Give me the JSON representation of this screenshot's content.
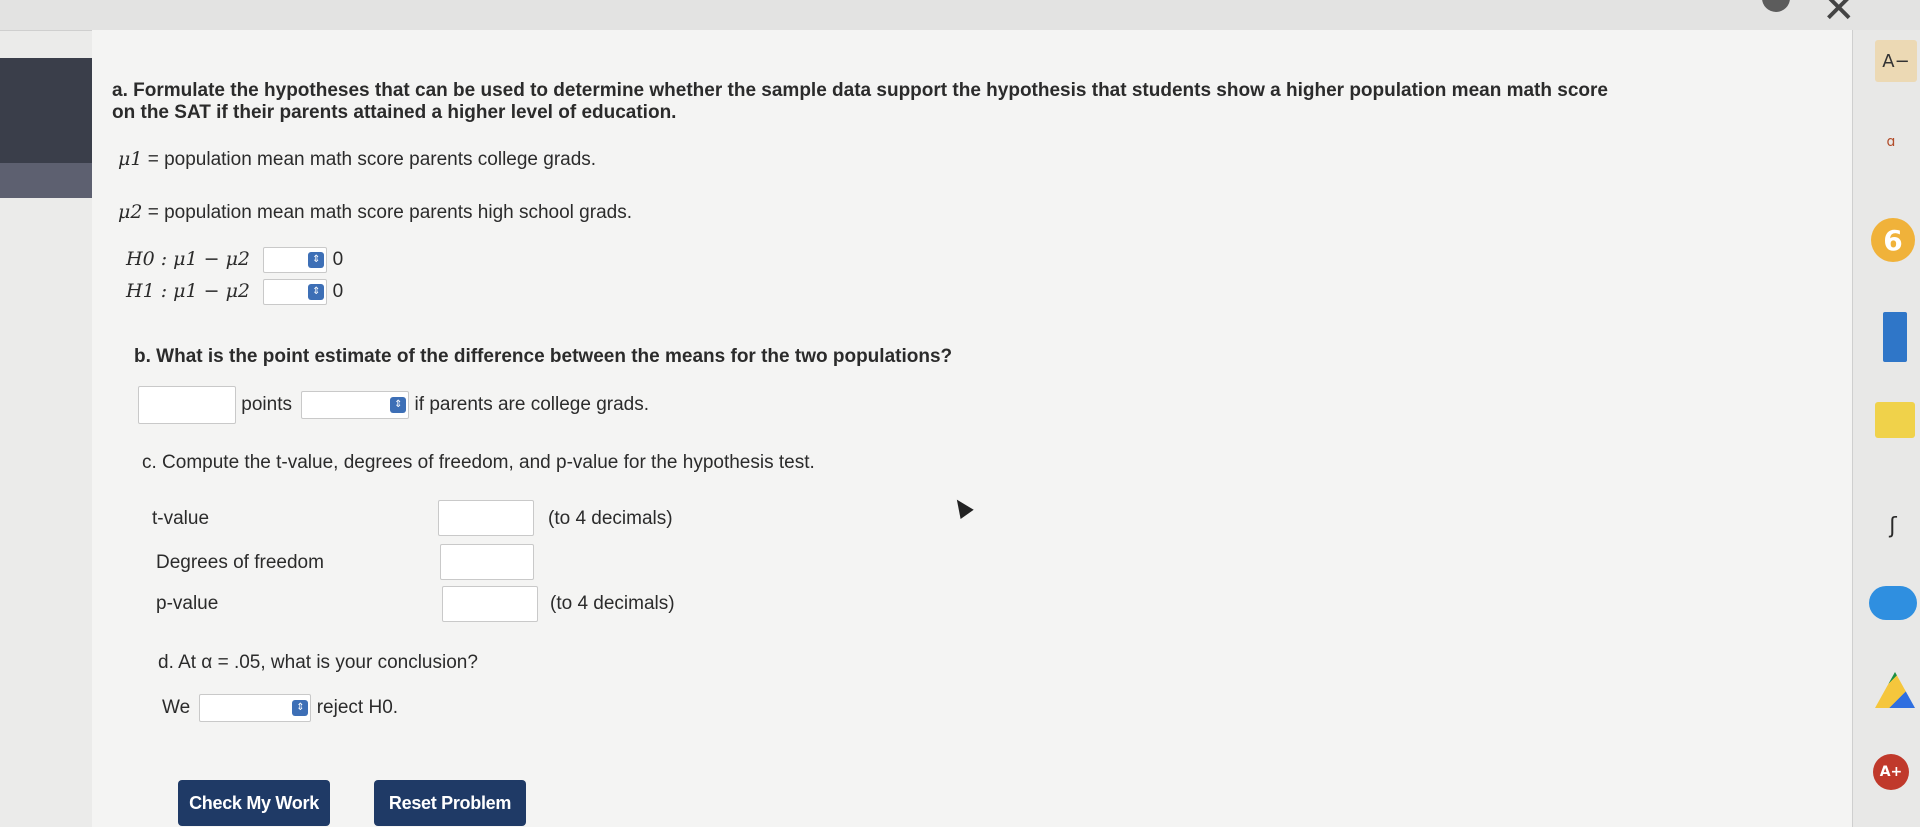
{
  "part_a": {
    "prompt_line1": "a. Formulate the hypotheses that can be used to determine whether the sample data support the hypothesis that students show a higher population mean math score",
    "prompt_line2": "on the SAT if their parents attained a higher level of education.",
    "mu1_symbol": "μ1",
    "mu1_def": "= population mean math score parents college grads.",
    "mu2_symbol": "μ2",
    "mu2_def": "= population mean math score parents high school grads.",
    "h0_label": "H0 : μ1 − μ2",
    "h1_label": "H1 : μ1 − μ2",
    "h0_value": "0",
    "h1_value": "0"
  },
  "part_b": {
    "question": "b. What is the point estimate of the difference between the means for the two populations?",
    "points_label": "points",
    "suffix": "if parents are college grads."
  },
  "part_c": {
    "question": "c. Compute the t-value, degrees of freedom, and p-value for the hypothesis test.",
    "t_label": "t-value",
    "t_note": "(to 4 decimals)",
    "df_label": "Degrees of freedom",
    "p_label": "p-value",
    "p_note": "(to 4 decimals)"
  },
  "part_d": {
    "question": "d. At α = .05, what is your conclusion?",
    "we_label": "We",
    "reject_label": "reject H0."
  },
  "buttons": {
    "check": "Check My Work",
    "reset": "Reset Problem"
  },
  "dock": {
    "top_label": "A−",
    "badge": "6"
  },
  "colors": {
    "button_bg": "#1f3a66",
    "select_arrow": "#3d6fb6"
  }
}
